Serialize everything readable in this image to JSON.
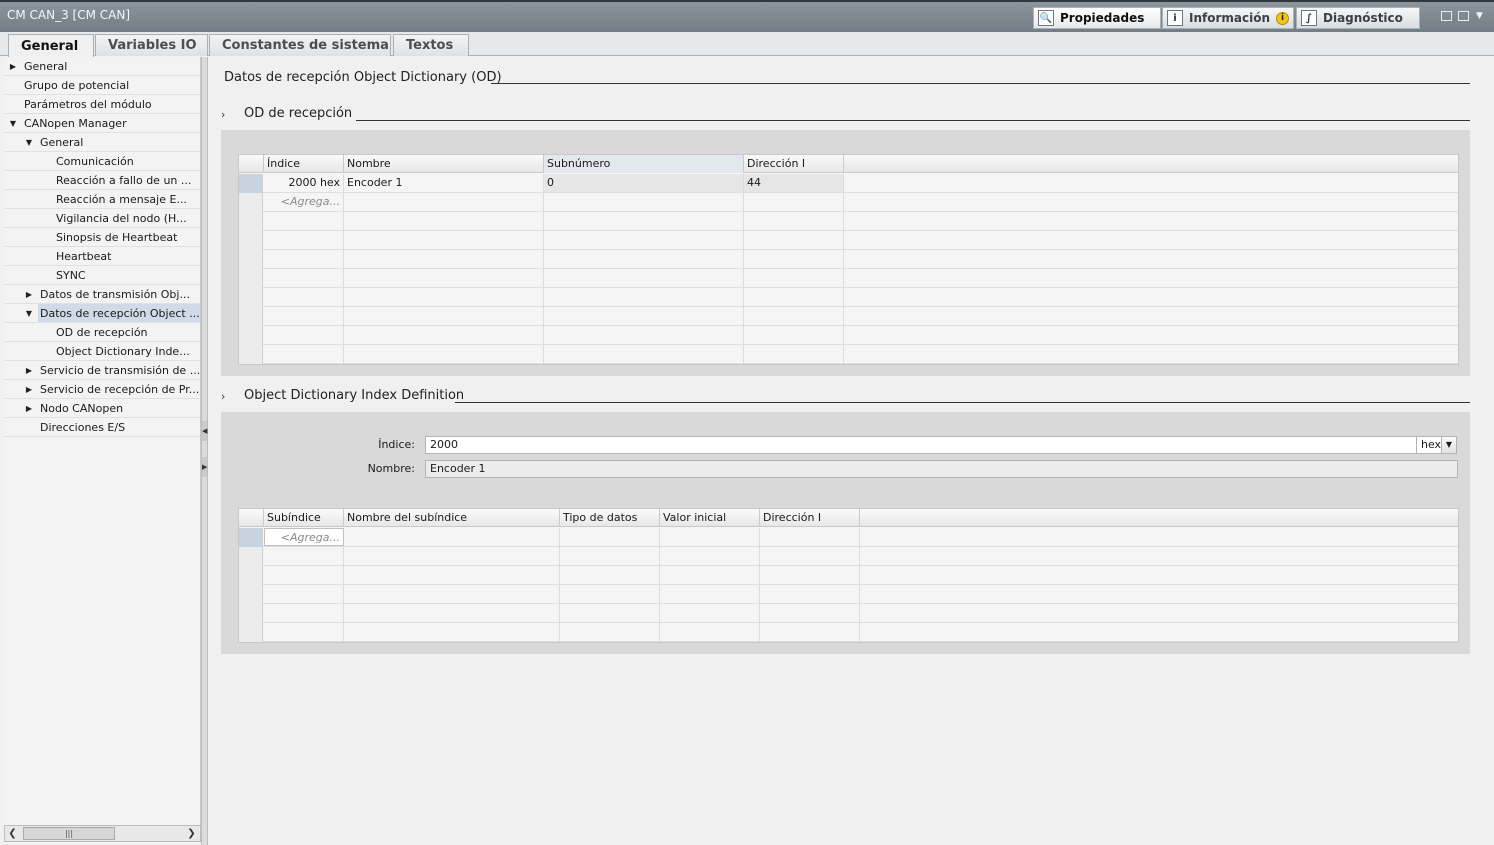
{
  "window": {
    "title": "CM CAN_3 [CM CAN]"
  },
  "inspector_tabs": [
    {
      "label": "Propiedades",
      "icon": "properties-icon",
      "active": true
    },
    {
      "label": "Información",
      "icon": "info-icon",
      "badge": "i"
    },
    {
      "label": "Diagnóstico",
      "icon": "diagnostics-icon"
    }
  ],
  "tabs": [
    "General",
    "Variables IO",
    "Constantes de sistema",
    "Textos"
  ],
  "tree": [
    {
      "label": "General",
      "level": 0,
      "expander": "collapsed"
    },
    {
      "label": "Grupo de potencial",
      "level": 0,
      "expander": "none"
    },
    {
      "label": "Parámetros del módulo",
      "level": 0,
      "expander": "none"
    },
    {
      "label": "CANopen Manager",
      "level": 0,
      "expander": "expanded"
    },
    {
      "label": "General",
      "level": 1,
      "expander": "expanded"
    },
    {
      "label": "Comunicación",
      "level": 2,
      "expander": "none"
    },
    {
      "label": "Reacción a fallo de un ...",
      "level": 2,
      "expander": "none"
    },
    {
      "label": "Reacción a mensaje E...",
      "level": 2,
      "expander": "none"
    },
    {
      "label": "Vigilancia del nodo (H...",
      "level": 2,
      "expander": "none"
    },
    {
      "label": "Sinopsis de Heartbeat",
      "level": 2,
      "expander": "none"
    },
    {
      "label": "Heartbeat",
      "level": 2,
      "expander": "none"
    },
    {
      "label": "SYNC",
      "level": 2,
      "expander": "none"
    },
    {
      "label": "Datos de transmisión Obj...",
      "level": 1,
      "expander": "collapsed"
    },
    {
      "label": "Datos de recepción Object ...",
      "level": 1,
      "expander": "expanded",
      "selected": true
    },
    {
      "label": "OD de recepción",
      "level": 2,
      "expander": "none"
    },
    {
      "label": "Object Dictionary Inde...",
      "level": 2,
      "expander": "none"
    },
    {
      "label": "Servicio de transmisión de ...",
      "level": 1,
      "expander": "collapsed"
    },
    {
      "label": "Servicio de recepción de Pr...",
      "level": 1,
      "expander": "collapsed"
    },
    {
      "label": "Nodo CANopen",
      "level": 1,
      "expander": "collapsed"
    },
    {
      "label": "Direcciones E/S",
      "level": 1,
      "expander": "none"
    }
  ],
  "main": {
    "heading": "Datos de recepción Object Dictionary (OD)",
    "od_section": {
      "title": "OD de recepción",
      "columns": [
        "Índice",
        "Nombre",
        "Subnúmero",
        "Dirección I"
      ],
      "rows": [
        [
          "2000 hex",
          "Encoder 1",
          "0",
          "44"
        ]
      ],
      "add_placeholder": "<Agrega..."
    },
    "index_section": {
      "title": "Object Dictionary Index Definition",
      "index_label": "Índice:",
      "index_value": "2000",
      "index_unit": "hex",
      "name_label": "Nombre:",
      "name_value": "Encoder 1",
      "columns": [
        "Subíndice",
        "Nombre del subíndice",
        "Tipo de datos",
        "Valor inicial",
        "Dirección I"
      ],
      "add_placeholder": "<Agrega..."
    }
  }
}
